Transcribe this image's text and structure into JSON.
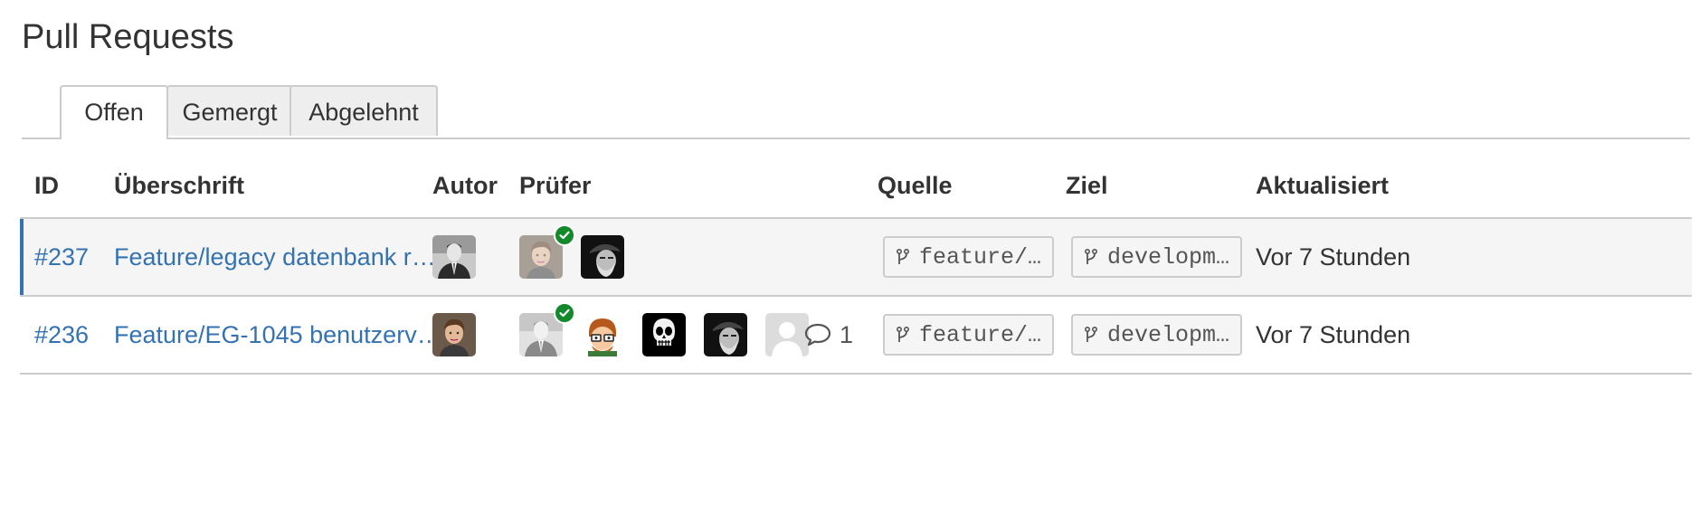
{
  "page": {
    "title": "Pull Requests"
  },
  "tabs": [
    {
      "label": "Offen",
      "active": true
    },
    {
      "label": "Gemergt",
      "active": false
    },
    {
      "label": "Abgelehnt",
      "active": false
    }
  ],
  "columns": {
    "id": "ID",
    "title": "Überschrift",
    "author": "Autor",
    "reviewers": "Prüfer",
    "source": "Quelle",
    "target": "Ziel",
    "updated": "Aktualisiert"
  },
  "rows": [
    {
      "id": "#237",
      "title": "Feature/legacy datenbank r…",
      "author_avatar": "avatar-suit-man",
      "reviewers": [
        {
          "avatar": "avatar-young-man-faded",
          "approved": true
        },
        {
          "avatar": "avatar-dark-hat-man",
          "approved": false
        }
      ],
      "comments": "",
      "source": "feature/…",
      "target": "developm…",
      "updated": "Vor 7 Stunden"
    },
    {
      "id": "#236",
      "title": "Feature/EG-1045 benutzerv…",
      "author_avatar": "avatar-young-man",
      "reviewers": [
        {
          "avatar": "avatar-suit-man-faded",
          "approved": true
        },
        {
          "avatar": "avatar-cartoon-glasses",
          "approved": false
        },
        {
          "avatar": "avatar-skull",
          "approved": false
        },
        {
          "avatar": "avatar-dark-hat-man",
          "approved": false
        },
        {
          "avatar": "avatar-default-user",
          "approved": false
        }
      ],
      "comments": "1",
      "source": "feature/…",
      "target": "developm…",
      "updated": "Vor 7 Stunden"
    }
  ],
  "colors": {
    "link": "#3572b0",
    "approved": "#14892c",
    "border": "#cccccc",
    "selected_row": "#f5f5f5"
  }
}
